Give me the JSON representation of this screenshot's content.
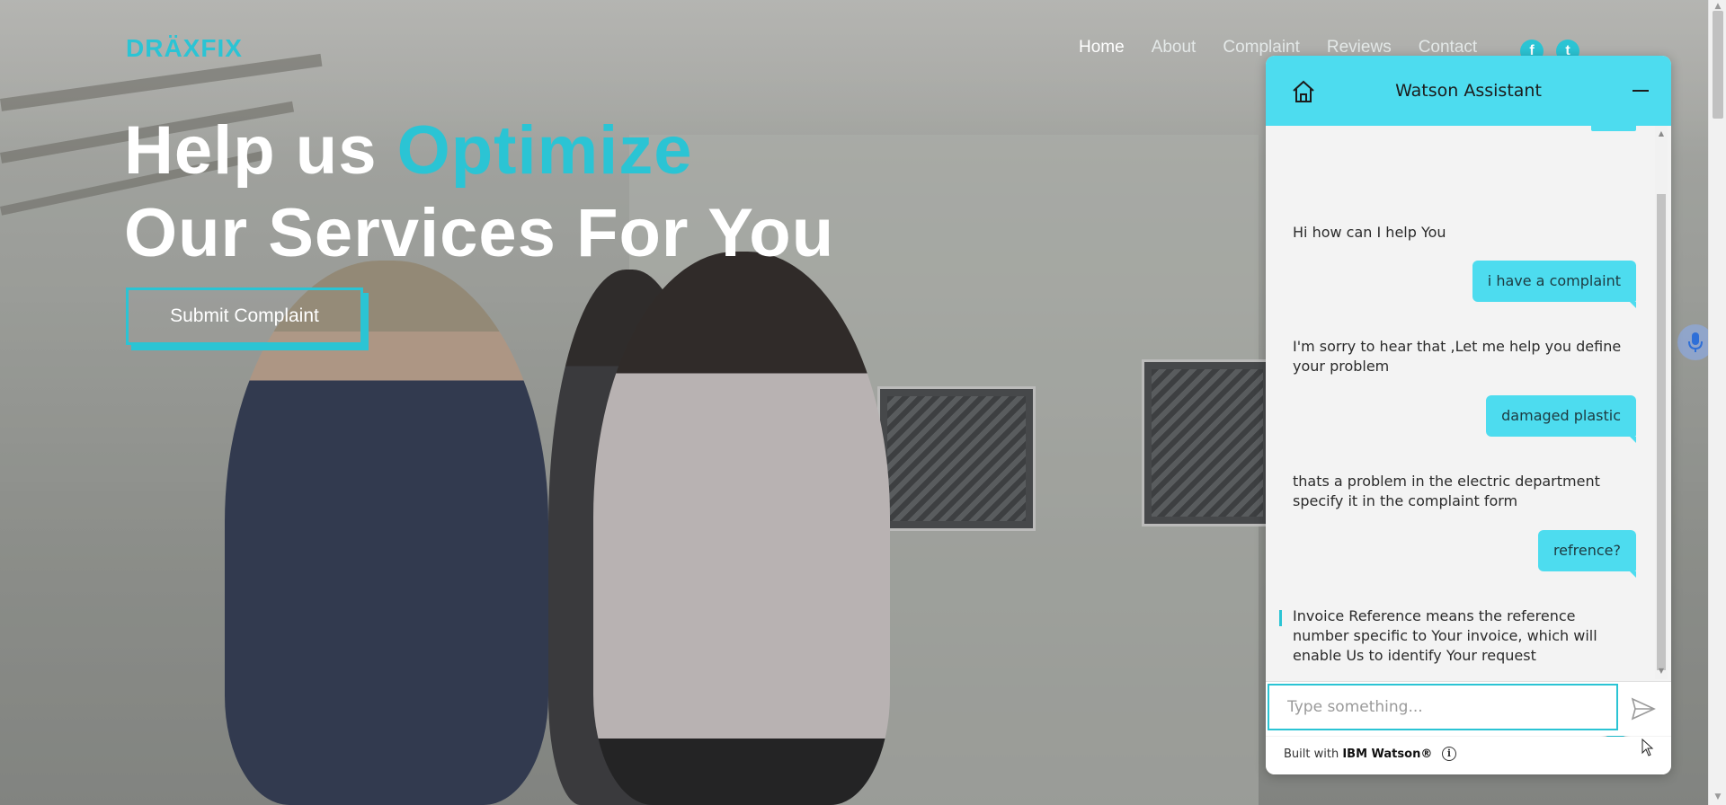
{
  "brand": {
    "name": "DRÄXFIX"
  },
  "nav": {
    "items": [
      "Home",
      "About",
      "Complaint",
      "Reviews",
      "Contact"
    ],
    "active": "Home"
  },
  "social": {
    "facebook": "f",
    "twitter": "t"
  },
  "hero": {
    "title_line1_prefix": "Help us ",
    "title_line1_accent": "Optimize",
    "title_line2": "Our Services For You",
    "cta_label": "Submit Complaint"
  },
  "colors": {
    "accent": "#2bc4d4",
    "chat_header": "#4ddcef",
    "chat_bg": "#f3f3f3"
  },
  "chat": {
    "title": "Watson Assistant",
    "messages": [
      {
        "from": "bot",
        "text": "Hi how can I help You"
      },
      {
        "from": "user",
        "text": "i have a complaint"
      },
      {
        "from": "bot",
        "text": "I'm sorry to hear that ,Let me help you define your problem"
      },
      {
        "from": "user",
        "text": "damaged plastic"
      },
      {
        "from": "bot",
        "text": "thats a problem in the electric department specify it in the complaint form"
      },
      {
        "from": "user",
        "text": "refrence?"
      },
      {
        "from": "bot",
        "text": "Invoice Reference means the reference number specific to Your invoice, which will enable Us to identify Your request"
      }
    ],
    "help_label": "?",
    "input_placeholder": "Type something...",
    "footer_prefix": "Built with ",
    "footer_brand": "IBM Watson®"
  },
  "icons": {
    "home": "home-icon",
    "minimize": "minimize-icon",
    "send": "send-icon",
    "info": "info-icon",
    "mic": "microphone-icon"
  }
}
